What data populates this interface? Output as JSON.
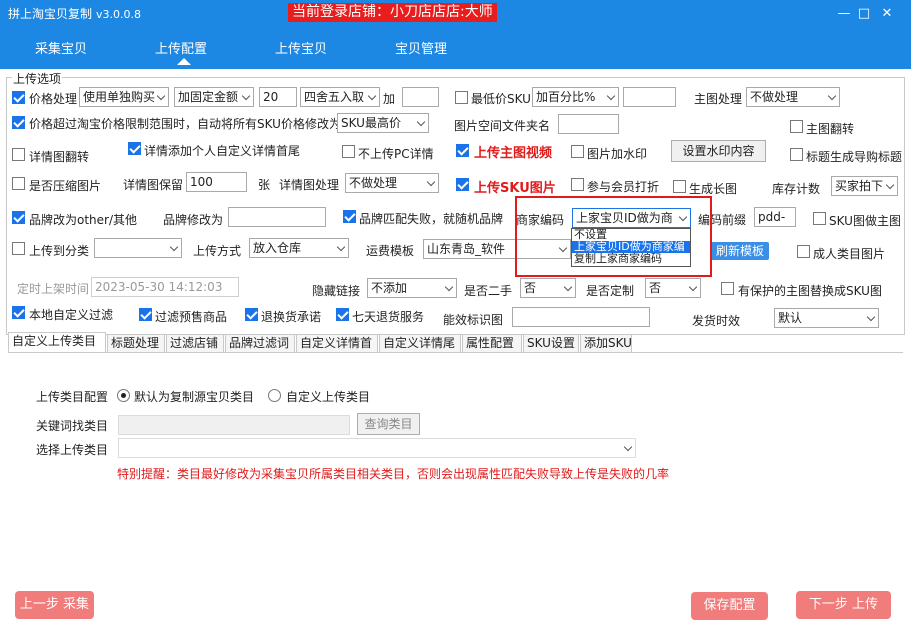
{
  "window": {
    "title": "拼上淘宝贝复制",
    "version": "v3.0.0.8",
    "shop_text": "当前登录店铺：小刀店店店:大师",
    "min": "—",
    "max": "□",
    "close": "✕"
  },
  "nav": [
    "采集宝贝",
    "上传配置",
    "上传宝贝",
    "宝贝管理"
  ],
  "group_title": "上传选项",
  "r1": {
    "price_label": "价格处理",
    "price_mode": "使用单独购买",
    "add_mode": "加固定金额",
    "add_value": "20",
    "round_mode": "四舍五入取",
    "plus_label": "加",
    "plus_value": "",
    "lowest_label": "最低价SKU",
    "lowest_mode": "加百分比%",
    "lowest_value": "",
    "main_img_label": "主图处理",
    "main_img_mode": "不做处理"
  },
  "r2": {
    "exceed_label": "价格超过淘宝价格限制范围时，自动将所有SKU价格修改为",
    "exceed_mode": "SKU最高价",
    "folder_label": "图片空间文件夹名",
    "folder_value": "",
    "main_flip": "主图翻转"
  },
  "r3": {
    "detail_flip": "详情图翻转",
    "detail_header": "详情添加个人自定义详情首尾",
    "no_pc": "不上传PC详情",
    "main_video": "上传主图视频",
    "watermark": "图片加水印",
    "set_watermark": "设置水印内容",
    "title_guide": "标题生成导购标题"
  },
  "r4": {
    "compress": "是否压缩图片",
    "keep_label": "详情图保留",
    "keep_value": "100",
    "keep_unit": "张",
    "detail_proc_label": "详情图处理",
    "detail_proc_mode": "不做处理",
    "sku_img": "上传SKU图片",
    "member_discount": "参与会员打折",
    "long_img": "生成长图",
    "stock_label": "库存计数",
    "stock_mode": "买家拍下"
  },
  "r5": {
    "brand_other": "品牌改为other/其他",
    "brand_change_label": "品牌修改为",
    "brand_change_value": "",
    "brand_random": "品牌匹配失败，就随机品牌",
    "merchant_code_label": "商家编码",
    "merchant_code_value": "上家宝贝ID做为商",
    "code_prefix_label": "编码前缀",
    "code_prefix_value": "pdd-",
    "sku_main": "SKU图做主图"
  },
  "dropdown": [
    "不设置",
    "上家宝贝ID做为商家编",
    "复制上家商家编码"
  ],
  "r6": {
    "upload_cat": "上传到分类",
    "cat_value": "",
    "method_label": "上传方式",
    "method_value": "放入仓库",
    "freight_label": "运费模板",
    "freight_value": "山东青岛_软件",
    "refresh": "刷新模板",
    "adult": "成人类目图片"
  },
  "r7": {
    "timed_label": "定时上架时间",
    "timed_value": "2023-05-30 14:12:03",
    "hide_link_label": "隐藏链接",
    "hide_link_value": "不添加",
    "second_hand_label": "是否二手",
    "second_hand_value": "否",
    "custom_label": "是否定制",
    "custom_value": "否",
    "protect": "有保护的主图替换成SKU图"
  },
  "r8": {
    "local_filter": "本地自定义过滤",
    "presale": "过滤预售商品",
    "return_promise": "退换货承诺",
    "seven_day": "七天退货服务",
    "capability_label": "能效标识图",
    "capability_value": "",
    "ship_label": "发货时效",
    "ship_value": "默认"
  },
  "tabs": [
    "自定义上传类目",
    "标题处理",
    "过滤店铺",
    "品牌过滤词",
    "自定义详情首",
    "自定义详情尾",
    "属性配置",
    "SKU设置",
    "添加SKU"
  ],
  "panel": {
    "cat_config_label": "上传类目配置",
    "opt_default": "默认为复制源宝贝类目",
    "opt_custom": "自定义上传类目",
    "keyword_label": "关键词找类目",
    "search_btn": "查询类目",
    "select_label": "选择上传类目",
    "warning": "特别提醒：类目最好修改为采集宝贝所属类目相关类目，否则会出现属性匹配失败导致上传是失败的几率"
  },
  "footer": {
    "prev": "上一步 采集",
    "save": "保存配置",
    "next": "下一步 上传"
  }
}
